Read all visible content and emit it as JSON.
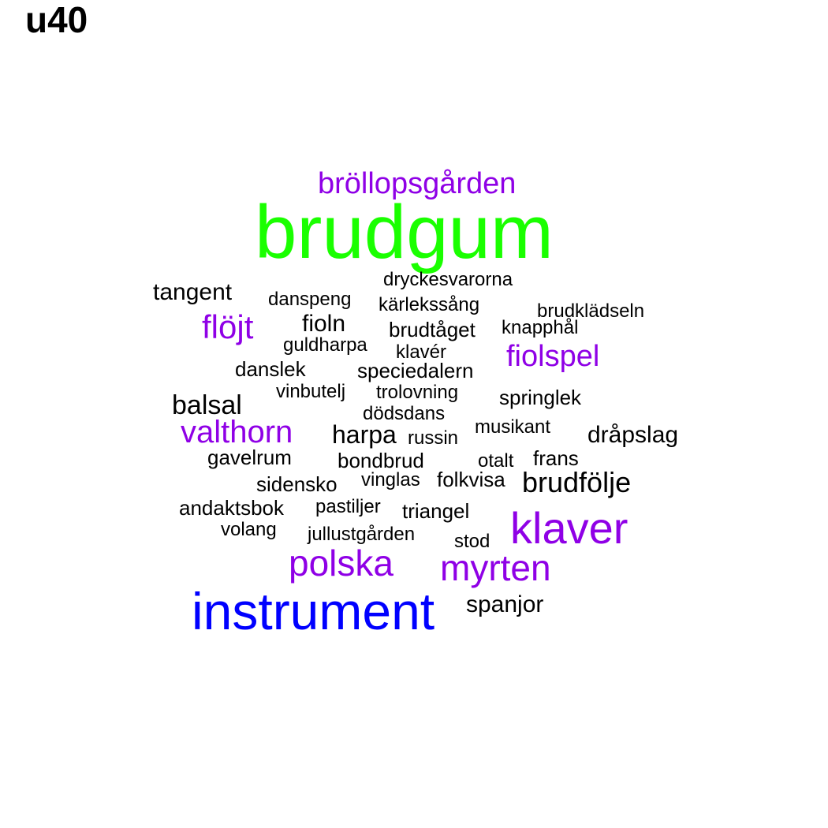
{
  "title": "u40",
  "colors": {
    "black": "#000000",
    "purple": "#8f00e6",
    "green": "#1aff00",
    "blue": "#0000ff"
  },
  "words": [
    {
      "text": "brudgum",
      "color": "green"
    },
    {
      "text": "instrument",
      "color": "blue"
    },
    {
      "text": "klaver",
      "color": "purple"
    },
    {
      "text": "myrten",
      "color": "purple"
    },
    {
      "text": "polska",
      "color": "purple"
    },
    {
      "text": "bröllopsgården",
      "color": "purple"
    },
    {
      "text": "valthorn",
      "color": "purple"
    },
    {
      "text": "flöjt",
      "color": "purple"
    },
    {
      "text": "fiolspel",
      "color": "purple"
    },
    {
      "text": "brudfölje",
      "color": "black"
    },
    {
      "text": "balsal",
      "color": "black"
    },
    {
      "text": "harpa",
      "color": "black"
    },
    {
      "text": "spanjor",
      "color": "black"
    },
    {
      "text": "dråpslag",
      "color": "black"
    },
    {
      "text": "tangent",
      "color": "black"
    },
    {
      "text": "fioln",
      "color": "black"
    },
    {
      "text": "dryckesvarorna",
      "color": "black"
    },
    {
      "text": "danspeng",
      "color": "black"
    },
    {
      "text": "kärlekssång",
      "color": "black"
    },
    {
      "text": "brudklädseln",
      "color": "black"
    },
    {
      "text": "brudtåget",
      "color": "black"
    },
    {
      "text": "knapphål",
      "color": "black"
    },
    {
      "text": "guldharpa",
      "color": "black"
    },
    {
      "text": "klavér",
      "color": "black"
    },
    {
      "text": "danslek",
      "color": "black"
    },
    {
      "text": "speciedalern",
      "color": "black"
    },
    {
      "text": "vinbutelj",
      "color": "black"
    },
    {
      "text": "trolovning",
      "color": "black"
    },
    {
      "text": "springlek",
      "color": "black"
    },
    {
      "text": "dödsdans",
      "color": "black"
    },
    {
      "text": "musikant",
      "color": "black"
    },
    {
      "text": "russin",
      "color": "black"
    },
    {
      "text": "gavelrum",
      "color": "black"
    },
    {
      "text": "bondbrud",
      "color": "black"
    },
    {
      "text": "otalt",
      "color": "black"
    },
    {
      "text": "frans",
      "color": "black"
    },
    {
      "text": "sidensko",
      "color": "black"
    },
    {
      "text": "vinglas",
      "color": "black"
    },
    {
      "text": "folkvisa",
      "color": "black"
    },
    {
      "text": "andaktsbok",
      "color": "black"
    },
    {
      "text": "pastiljer",
      "color": "black"
    },
    {
      "text": "triangel",
      "color": "black"
    },
    {
      "text": "volang",
      "color": "black"
    },
    {
      "text": "jullustgården",
      "color": "black"
    },
    {
      "text": "stod",
      "color": "black"
    }
  ]
}
